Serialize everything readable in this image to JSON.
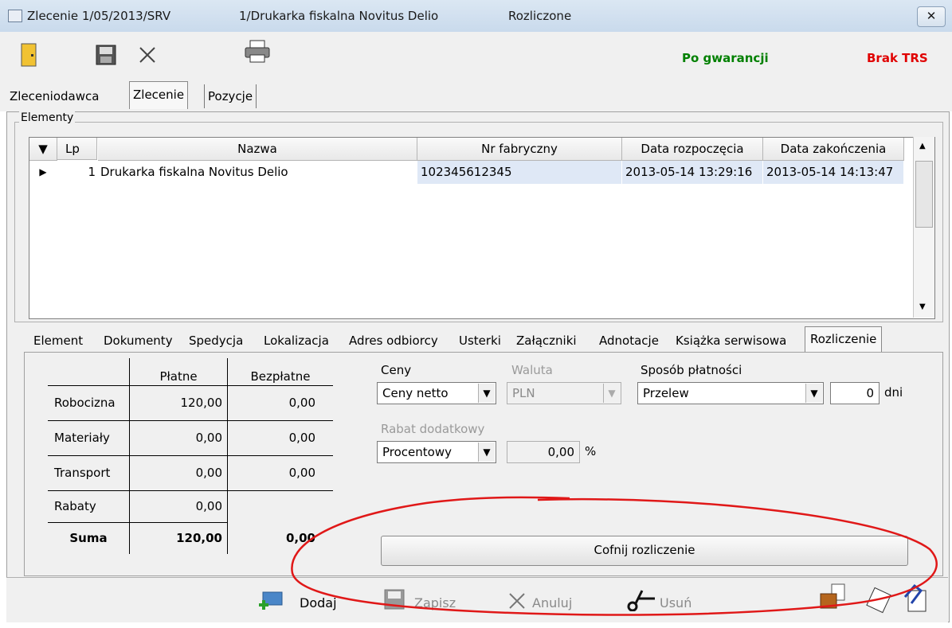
{
  "window": {
    "order": "Zlecenie 1/05/2013/SRV",
    "item": "1/Drukarka fiskalna Novitus Delio",
    "status": "Rozliczone",
    "close_label": "✕"
  },
  "toolbar": {
    "warranty": "Po gwarancji",
    "trs": "Brak TRS",
    "colors": {
      "warranty": "#008000",
      "trs": "#e00000"
    }
  },
  "tabs": [
    "Zleceniodawca",
    "Zlecenie",
    "Pozycje"
  ],
  "elements": {
    "group_label": "Elementy",
    "columns": {
      "lp": "Lp",
      "name": "Nazwa",
      "serial": "Nr fabryczny",
      "start": "Data rozpoczęcia",
      "end": "Data zakończenia"
    },
    "rows": [
      {
        "lp": "1",
        "name": "Drukarka fiskalna Novitus Delio",
        "serial": "102345612345",
        "start": "2013-05-14 13:29:16",
        "end": "2013-05-14 14:13:47"
      }
    ]
  },
  "subtabs": [
    "Element",
    "Dokumenty",
    "Spedycja",
    "Lokalizacja",
    "Adres odbiorcy",
    "Usterki",
    "Załączniki",
    "Adnotacje",
    "Książka serwisowa",
    "Rozliczenie"
  ],
  "summary": {
    "col_paid": "Płatne",
    "col_free": "Bezpłatne",
    "rows": [
      {
        "label": "Robocizna",
        "paid": "120,00",
        "free": "0,00"
      },
      {
        "label": "Materiały",
        "paid": "0,00",
        "free": "0,00"
      },
      {
        "label": "Transport",
        "paid": "0,00",
        "free": "0,00"
      },
      {
        "label": "Rabaty",
        "paid": "0,00",
        "free": ""
      }
    ],
    "total": {
      "label": "Suma",
      "paid": "120,00",
      "free": "0,00"
    }
  },
  "pricing": {
    "prices_label": "Ceny",
    "prices_value": "Ceny netto",
    "currency_label": "Waluta",
    "currency_value": "PLN",
    "payment_label": "Sposób płatności",
    "payment_value": "Przelew",
    "days_value": "0",
    "days_unit": "dni",
    "discount_label": "Rabat dodatkowy",
    "discount_type": "Procentowy",
    "discount_value": "0,00",
    "discount_unit": "%"
  },
  "undo_button": "Cofnij rozliczenie",
  "bottom": {
    "add": "Dodaj",
    "save": "Zapisz",
    "cancel": "Anuluj",
    "delete": "Usuń"
  }
}
